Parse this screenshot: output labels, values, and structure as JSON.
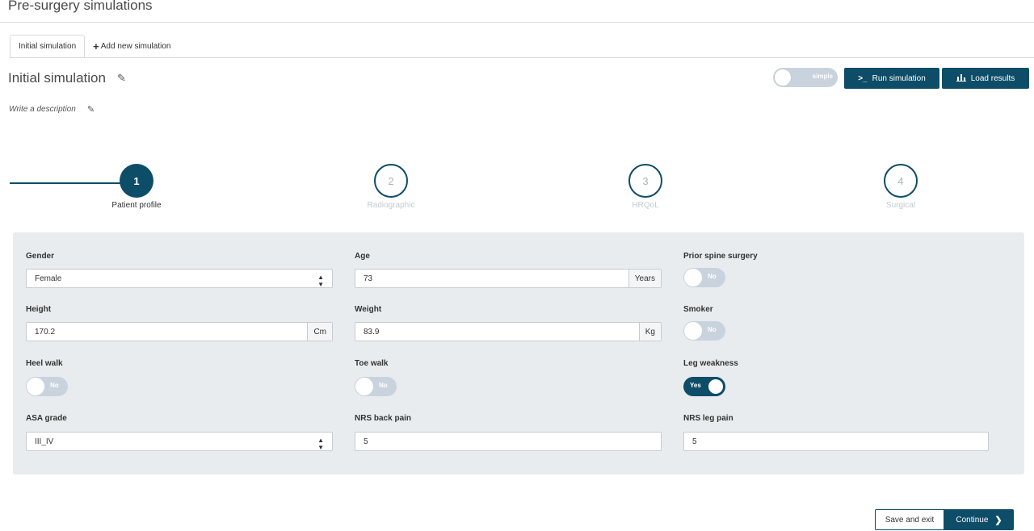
{
  "page": {
    "title": "Pre-surgery simulations"
  },
  "tabs": [
    {
      "label": "Initial simulation",
      "active": true
    },
    {
      "label": "Add new simulation",
      "icon": "plus-icon"
    }
  ],
  "simulation": {
    "title": "Initial simulation",
    "description_placeholder": "Write a description"
  },
  "toolbar": {
    "mode_label": "simple",
    "run_label": "Run simulation",
    "load_label": "Load results"
  },
  "steps": [
    {
      "number": "1",
      "label": "Patient profile",
      "state": "current"
    },
    {
      "number": "2",
      "label": "Radiographic",
      "state": "pending"
    },
    {
      "number": "3",
      "label": "HRQoL",
      "state": "pending"
    },
    {
      "number": "4",
      "label": "Surgical",
      "state": "pending"
    }
  ],
  "form": {
    "gender": {
      "label": "Gender",
      "value": "Female"
    },
    "age": {
      "label": "Age",
      "value": "73",
      "unit": "Years"
    },
    "prior_spine_surgery": {
      "label": "Prior spine surgery",
      "value": "No"
    },
    "height": {
      "label": "Height",
      "value": "170.2",
      "unit": "Cm"
    },
    "weight": {
      "label": "Weight",
      "value": "83.9",
      "unit": "Kg"
    },
    "smoker": {
      "label": "Smoker",
      "value": "No"
    },
    "heel_walk": {
      "label": "Heel walk",
      "value": "No"
    },
    "toe_walk": {
      "label": "Toe walk",
      "value": "No"
    },
    "leg_weakness": {
      "label": "Leg weakness",
      "value": "Yes"
    },
    "asa_grade": {
      "label": "ASA grade",
      "value": "III_IV"
    },
    "nrs_back_pain": {
      "label": "NRS back pain",
      "value": "5"
    },
    "nrs_leg_pain": {
      "label": "NRS leg pain",
      "value": "5"
    }
  },
  "footer": {
    "save_label": "Save and exit",
    "continue_label": "Continue"
  },
  "colors": {
    "primary": "#0e4d68",
    "panel_bg": "#e8ecef",
    "toggle_off": "#c9d3de"
  }
}
